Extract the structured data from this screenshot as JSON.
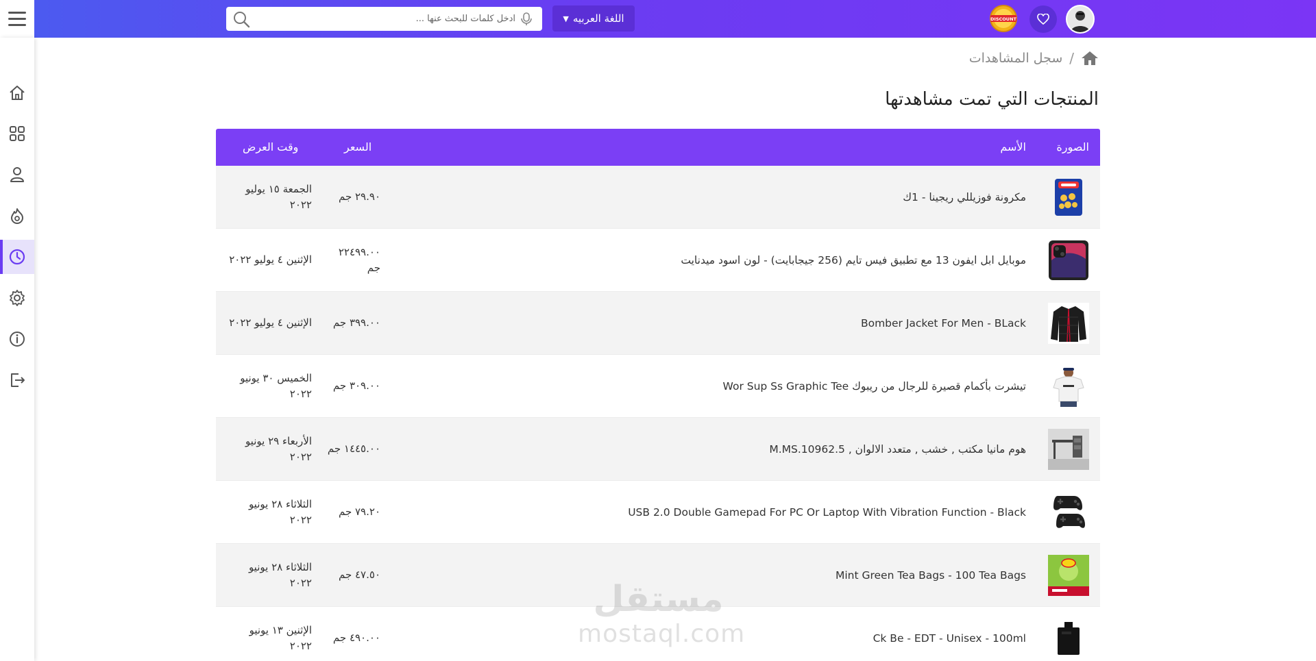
{
  "header": {
    "search_placeholder": "ادخل كلمات للبحث عنها ...",
    "language_label": "اللغة العربيه",
    "discount_label": "DISCOUNT"
  },
  "breadcrumb": {
    "current": "سجل المشاهدات"
  },
  "page": {
    "title": "المنتجات التي تمت مشاهدتها"
  },
  "table": {
    "columns": {
      "image": "الصورة",
      "name": "الأسم",
      "price": "السعر",
      "time": "وقت العرض"
    },
    "rows": [
      {
        "name": "مكرونة فوزيللي ريجينا - 1ك",
        "price": "٢٩.٩٠ جم",
        "time": "الجمعة ١٥ يوليو ٢٠٢٢",
        "thumb": "pasta"
      },
      {
        "name": "موبايل ابل ايفون 13 مع تطبيق فيس تايم (256 جيجابايت) - لون اسود ميدنايت",
        "price": "٢٢٤٩٩.٠٠ جم",
        "time": "الإثنين ٤ يوليو ٢٠٢٢",
        "thumb": "phone"
      },
      {
        "name": "Bomber Jacket For Men - BLack",
        "price": "٣٩٩.٠٠ جم",
        "time": "الإثنين ٤ يوليو ٢٠٢٢",
        "thumb": "jacket"
      },
      {
        "name": "تيشرت بأكمام قصيرة للرجال من ريبوك Wor Sup Ss Graphic Tee",
        "price": "٣٠٩.٠٠ جم",
        "time": "الخميس ٣٠ يونيو ٢٠٢٢",
        "thumb": "tshirt"
      },
      {
        "name": "هوم مانيا مكتب , خشب , متعدد الالوان , M.MS.10962.5",
        "price": "١٤٤٥.٠٠ جم",
        "time": "الأربعاء ٢٩ يونيو ٢٠٢٢",
        "thumb": "desk"
      },
      {
        "name": "USB 2.0 Double Gamepad For PC Or Laptop With Vibration Function - Black",
        "price": "٧٩.٢٠ جم",
        "time": "الثلاثاء ٢٨ يونيو ٢٠٢٢",
        "thumb": "gamepad"
      },
      {
        "name": "Mint Green Tea Bags - 100 Tea Bags",
        "price": "٤٧.٥٠ جم",
        "time": "الثلاثاء ٢٨ يونيو ٢٠٢٢",
        "thumb": "tea"
      },
      {
        "name": "Ck Be - EDT - Unisex - 100ml",
        "price": "٤٩٠.٠٠ جم",
        "time": "الإثنين ١٣ يونيو ٢٠٢٢",
        "thumb": "perfume"
      }
    ]
  },
  "watermark": {
    "logo": "مستقل",
    "domain": "mostaql.com"
  },
  "colors": {
    "accent": "#7b3ff5",
    "header_start": "#4a5cf0",
    "header_end": "#7b35f5",
    "active_nav_bg": "#e7e2fb"
  },
  "icons": {
    "sidebar": [
      "home-icon",
      "grid-icon",
      "user-icon",
      "fire-icon",
      "clock-icon",
      "gear-icon",
      "info-icon",
      "logout-icon"
    ],
    "header": [
      "menu-icon",
      "search-icon",
      "microphone-icon",
      "heart-icon",
      "avatar"
    ]
  }
}
